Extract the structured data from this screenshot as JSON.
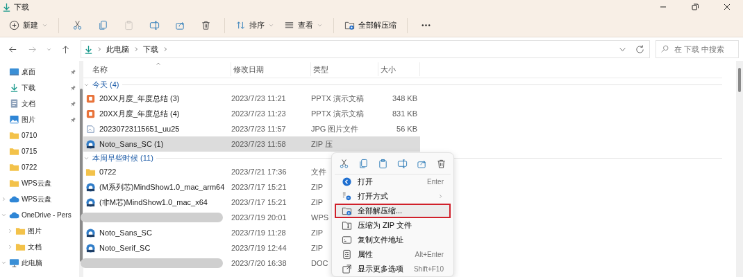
{
  "window": {
    "title": "下载"
  },
  "toolbar": [
    {
      "kind": "button",
      "label": "新建",
      "caret": true
    },
    {
      "kind": "separator"
    },
    {
      "kind": "icon",
      "disabled": false
    },
    {
      "kind": "icon",
      "disabled": false
    },
    {
      "kind": "icon",
      "disabled": true
    },
    {
      "kind": "icon",
      "disabled": false
    },
    {
      "kind": "icon",
      "disabled": false
    },
    {
      "kind": "icon",
      "disabled": false
    },
    {
      "kind": "separator"
    },
    {
      "kind": "button",
      "label": "排序",
      "caret": true
    },
    {
      "kind": "button",
      "label": "查看",
      "caret": true
    },
    {
      "kind": "separator"
    },
    {
      "kind": "button",
      "label": "全部解压缩",
      "caret": false
    },
    {
      "kind": "separator"
    },
    {
      "kind": "icon",
      "disabled": false
    }
  ],
  "navigation": {
    "back_disabled": false,
    "forward_disabled": true
  },
  "address": {
    "breadcrumbs": [
      "此电脑",
      "下载"
    ]
  },
  "search": {
    "placeholder": "在 下载 中搜索"
  },
  "sidebar": {
    "items": [
      {
        "label": "桌面",
        "pinned": true
      },
      {
        "label": "下载",
        "pinned": true
      },
      {
        "label": "文档",
        "pinned": true
      },
      {
        "label": "图片",
        "pinned": true
      },
      {
        "label": "0710",
        "pinned": false
      },
      {
        "label": "0715",
        "pinned": false
      },
      {
        "label": "0722",
        "pinned": false
      },
      {
        "label": "WPS云盘",
        "pinned": false
      },
      {
        "label": "WPS云盘",
        "pinned": false,
        "expanded": false
      },
      {
        "label": "OneDrive - Pers",
        "pinned": false,
        "expanded": true,
        "children": [
          {
            "label": "图片",
            "pinned": false,
            "expanded": false
          },
          {
            "label": "文档",
            "pinned": false,
            "expanded": false
          }
        ]
      },
      {
        "label": "此电脑",
        "pinned": false,
        "expanded": true
      }
    ]
  },
  "table": {
    "columns": [
      "名称",
      "修改日期",
      "类型",
      "大小"
    ],
    "groups": [
      {
        "label": "今天 (4)",
        "expanded": true,
        "rows": [
          {
            "kind": "file",
            "name": "20XX月度_年度总结 (3)",
            "date": "2023/7/23 11:21",
            "type": "PPTX 演示文稿",
            "size": "348 KB",
            "selected": false
          },
          {
            "kind": "file",
            "name": "20XX月度_年度总结 (4)",
            "date": "2023/7/23 11:23",
            "type": "PPTX 演示文稿",
            "size": "831 KB",
            "selected": false
          },
          {
            "kind": "file",
            "name": "20230723115651_uu25",
            "date": "2023/7/23 11:57",
            "type": "JPG 图片文件",
            "size": "56 KB",
            "selected": false
          },
          {
            "kind": "file",
            "name": "Noto_Sans_SC (1)",
            "date": "2023/7/23 11:58",
            "type": "ZIP 压",
            "selected": true
          }
        ]
      },
      {
        "label": "本周早些时候 (11)",
        "expanded": true,
        "rows": [
          {
            "kind": "file",
            "name": "0722",
            "date": "2023/7/21 17:36",
            "type": "文件",
            "selected": false
          },
          {
            "kind": "file",
            "name": "(M系列芯)MindShow1.0_mac_arm64",
            "date": "2023/7/17 15:21",
            "type": "ZIP",
            "selected": false
          },
          {
            "kind": "file",
            "name": "(非M芯)MindShow1.0_mac_x64",
            "date": "2023/7/17 15:21",
            "type": "ZIP",
            "selected": false
          },
          {
            "kind": "redacted",
            "date": "2023/7/19 20:01",
            "type": "WPS",
            "selected": false
          },
          {
            "kind": "file",
            "name": "Noto_Sans_SC",
            "date": "2023/7/19 11:28",
            "type": "ZIP",
            "selected": false
          },
          {
            "kind": "file",
            "name": "Noto_Serif_SC",
            "date": "2023/7/19 12:44",
            "type": "ZIP",
            "selected": false
          },
          {
            "kind": "redacted",
            "date": "2023/7/20 16:38",
            "type": "DOC",
            "selected": false
          }
        ]
      }
    ]
  },
  "context_menu": {
    "items": [
      {
        "label": "打开",
        "shortcut": "Enter",
        "submenu": false,
        "highlighted": false
      },
      {
        "label": "打开方式",
        "submenu": true,
        "highlighted": false
      },
      {
        "label": "全部解压缩...",
        "submenu": false,
        "highlighted": true
      },
      {
        "label": "压缩为 ZIP 文件",
        "submenu": false,
        "highlighted": false
      },
      {
        "label": "复制文件地址",
        "submenu": false,
        "highlighted": false
      },
      {
        "label": "属性",
        "shortcut": "Alt+Enter",
        "submenu": false,
        "highlighted": false
      },
      {
        "label": "显示更多选项",
        "shortcut": "Shift+F10",
        "submenu": false,
        "highlighted": false
      }
    ]
  }
}
